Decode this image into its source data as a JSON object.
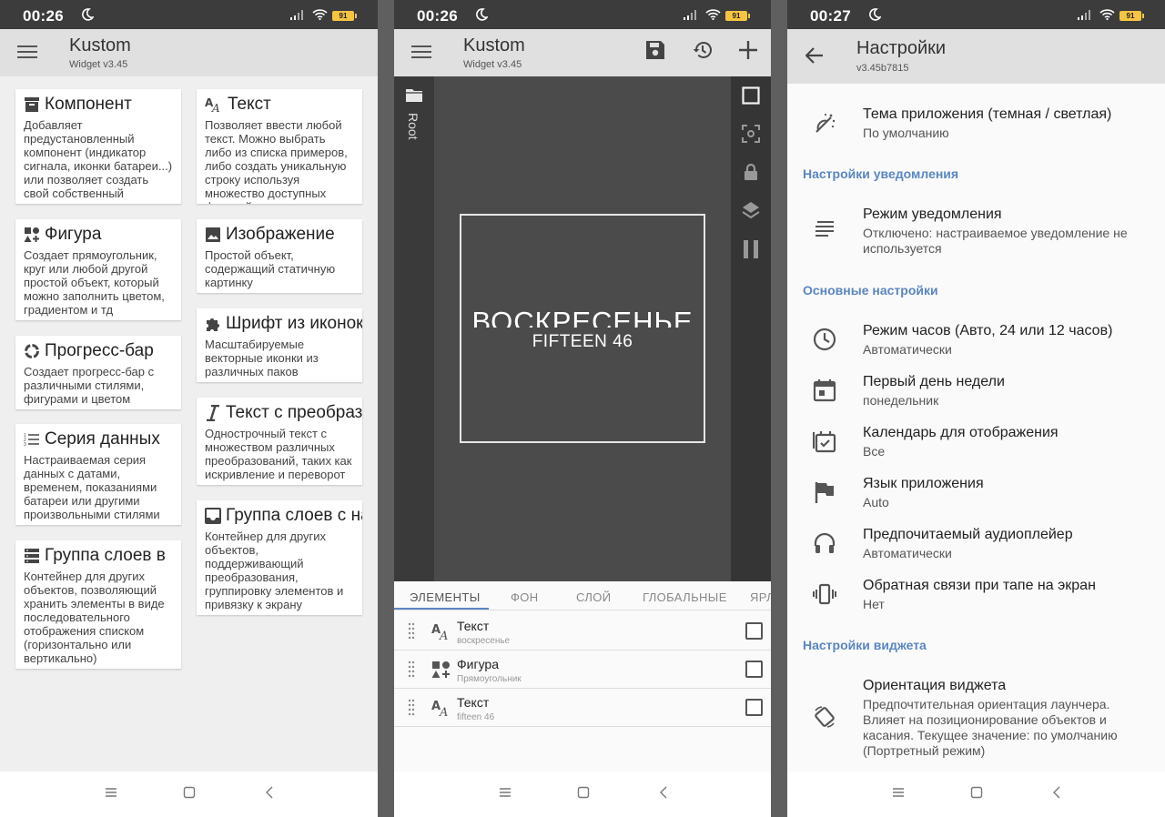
{
  "status": {
    "time1": "00:26",
    "time2": "00:26",
    "time3": "00:27",
    "battery": "91"
  },
  "colors": {
    "accent": "#5b86c1",
    "statusbar": "#3c3c3c",
    "appbar": "#e0e0e0",
    "editor_bg": "#4b4b4b"
  },
  "app": {
    "title": "Kustom",
    "subtitle": "Widget v3.45"
  },
  "components": [
    {
      "icon": "archive-icon",
      "title": "Компонент",
      "desc": "Добавляет предустановленный компонент (индикатор сигнала, иконки батареи...) или позволяет создать свой собственный"
    },
    {
      "icon": "shapes-icon",
      "title": "Фигура",
      "desc": "Создает прямоугольник, круг или любой другой простой объект, который можно заполнить цветом, градиентом и тд"
    },
    {
      "icon": "progress-icon",
      "title": "Прогресс-бар",
      "desc": "Создает прогресс-бар с различными стилями, фигурами и цветом"
    },
    {
      "icon": "list-icon",
      "title": "Серия данных",
      "desc": "Настраиваемая серия данных с датами, временем, показаниями батареи или другими произвольными стилями"
    },
    {
      "icon": "stack-icon",
      "title": "Группа слоев в",
      "desc": "Контейнер для других объектов, позволяющий хранить элементы в виде последовательного отображения списком (горизонтально или вертикально)"
    },
    {
      "icon": "text-icon",
      "title": "Текст",
      "desc": "Позволяет ввести любой текст. Можно выбрать либо из списка примеров, либо создать уникальную строку используя множество доступных функций"
    },
    {
      "icon": "image-icon",
      "title": "Изображение",
      "desc": "Простой объект, содержащий статичную картинку"
    },
    {
      "icon": "puzzle-icon",
      "title": "Шрифт из иконок",
      "desc": "Масштабируемые векторные иконки из различных паков"
    },
    {
      "icon": "italic-text-icon",
      "title": "Текст с преобразованием",
      "desc": "Однострочный текст с множеством различных преобразований, таких как искривление и переворот"
    },
    {
      "icon": "inbox-icon",
      "title": "Группа слоев с наложением",
      "desc": "Контейнер для других объектов, поддерживающий преобразования, группировку элементов и привязку к экрану"
    }
  ],
  "editor": {
    "root_label": "Root",
    "preview": {
      "day": "ВОСКРЕСЕНЬЕ",
      "time": "FIFTEEN 46"
    },
    "tabs": [
      "ЭЛЕМЕНТЫ",
      "ФОН",
      "СЛОЙ",
      "ГЛОБАЛЬНЫЕ",
      "ЯРЛЫКИ"
    ],
    "layers": [
      {
        "icon": "text-icon",
        "title": "Текст",
        "sub": "воскресенье"
      },
      {
        "icon": "shapes-icon",
        "title": "Фигура",
        "sub": "Прямоугольник"
      },
      {
        "icon": "text-icon",
        "title": "Текст",
        "sub": "fifteen 46"
      }
    ]
  },
  "settings": {
    "title": "Настройки",
    "version": "v3.45b7815",
    "theme": {
      "title": "Тема приложения (темная / светлая)",
      "value": "По умолчанию"
    },
    "sec_notify": "Настройки уведомления",
    "notify": {
      "title": "Режим уведомления",
      "value": "Отключено: настраиваемое уведомление не используется"
    },
    "sec_main": "Основные настройки",
    "main_items": [
      {
        "icon": "clock-icon",
        "title": "Режим часов (Авто, 24 или 12 часов)",
        "value": "Автоматически"
      },
      {
        "icon": "calendar-icon",
        "title": "Первый день недели",
        "value": "понедельник"
      },
      {
        "icon": "calendar-check-icon",
        "title": "Календарь для отображения",
        "value": "Все"
      },
      {
        "icon": "flag-icon",
        "title": "Язык приложения",
        "value": "Auto"
      },
      {
        "icon": "headphones-icon",
        "title": "Предпочитаемый аудиоплейер",
        "value": "Автоматически"
      },
      {
        "icon": "vibrate-icon",
        "title": "Обратная связи при тапе на экран",
        "value": "Нет"
      }
    ],
    "sec_widget": "Настройки виджета",
    "orientation": {
      "title": "Ориентация виджета",
      "value": "Предпочтительная ориентация лаунчера. Влияет на позиционирование объектов и касания. Текущее значение: по умолчанию (Портретный режим)"
    }
  }
}
